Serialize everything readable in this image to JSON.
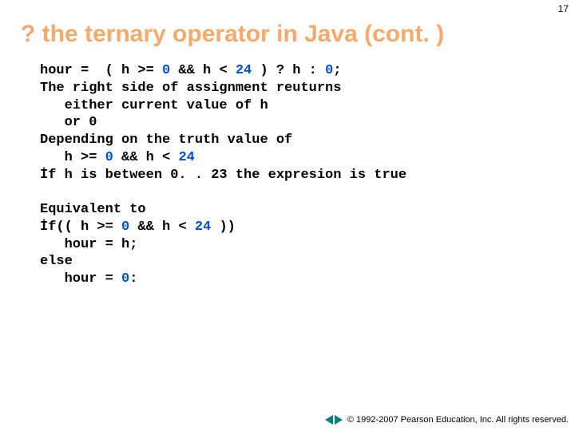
{
  "page_number": "17",
  "title": "? the ternary operator in Java (cont. )",
  "code_block1": {
    "l1a": "hour =  ( h >= ",
    "l1b": "0",
    "l1c": " && h < ",
    "l1d": "24",
    "l1e": " ) ? h : ",
    "l1f": "0",
    "l1g": ";",
    "l2": "The right side of assignment reuturns",
    "l3": "   either current value of h",
    "l4": "   or 0",
    "l5": "Depending on the truth value of",
    "l6a": "   h >= ",
    "l6b": "0",
    "l6c": " && h < ",
    "l6d": "24",
    "l7": "İf h is between 0. . 23 the expresion is true"
  },
  "code_block2": {
    "l1": "Equivalent to",
    "l2a": "İf(( h >= ",
    "l2b": "0",
    "l2c": " && h < ",
    "l2d": "24",
    "l2e": " ))",
    "l3": "   hour = h;",
    "l4": "else",
    "l5a": "   hour = ",
    "l5b": "0",
    "l5c": ":"
  },
  "footer": {
    "copyright": "© 1992-2007 Pearson Education, Inc. All rights reserved."
  }
}
